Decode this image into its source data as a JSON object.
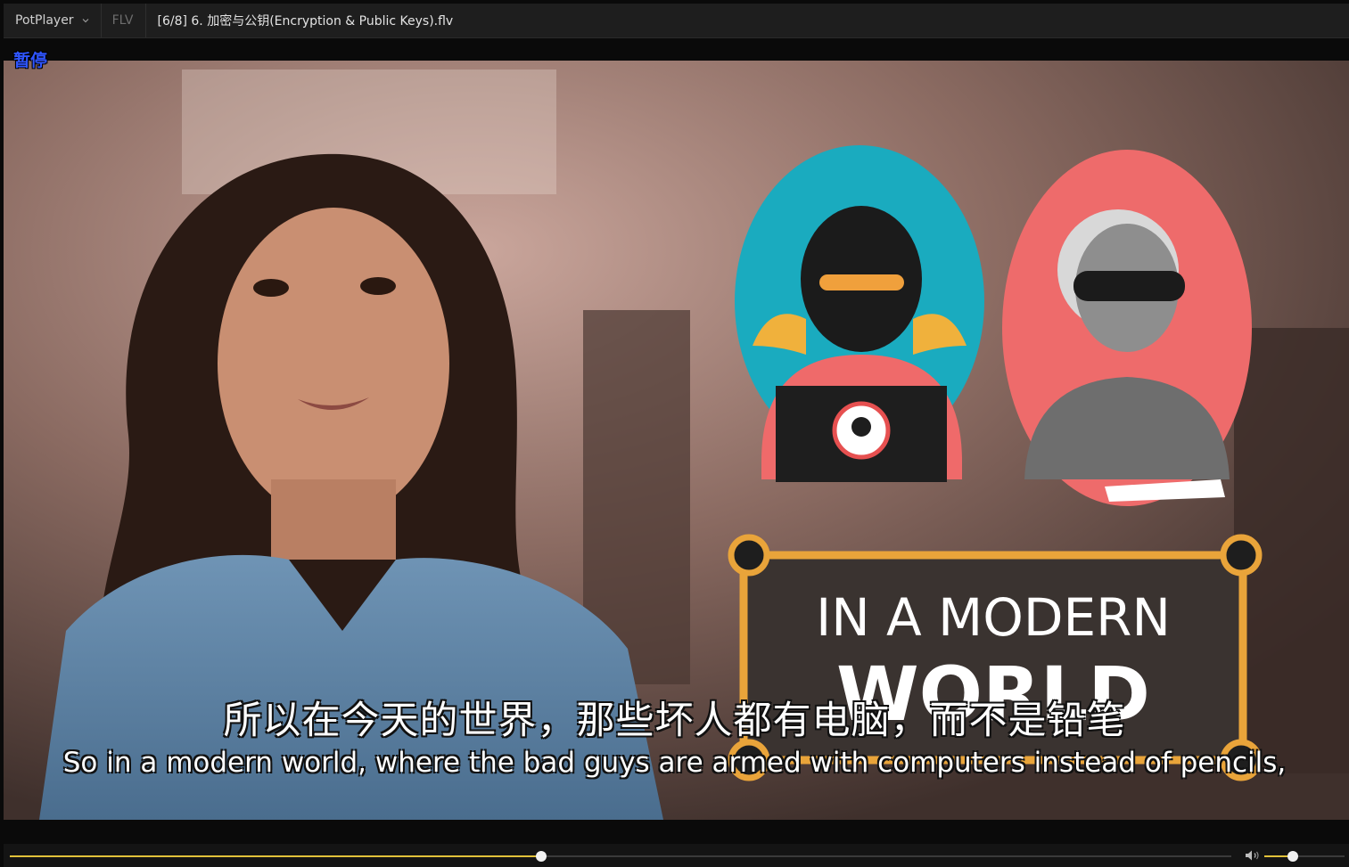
{
  "titlebar": {
    "app_name": "PotPlayer",
    "format": "FLV",
    "file_title": "[6/8] 6. 加密与公钥(Encryption & Public Keys).flv"
  },
  "osd": {
    "status": "暂停"
  },
  "video": {
    "sign_line1": "IN A MODERN",
    "sign_line2": "WORLD"
  },
  "subtitles": {
    "chinese": "所以在今天的世界，那些坏人都有电脑，而不是铅笔",
    "english": "So in a modern world, where the bad guys are armed with computers instead of pencils,"
  },
  "controls": {
    "seek_progress": 0.435,
    "volume_level": 0.35,
    "accent_color": "#e2c23a"
  }
}
